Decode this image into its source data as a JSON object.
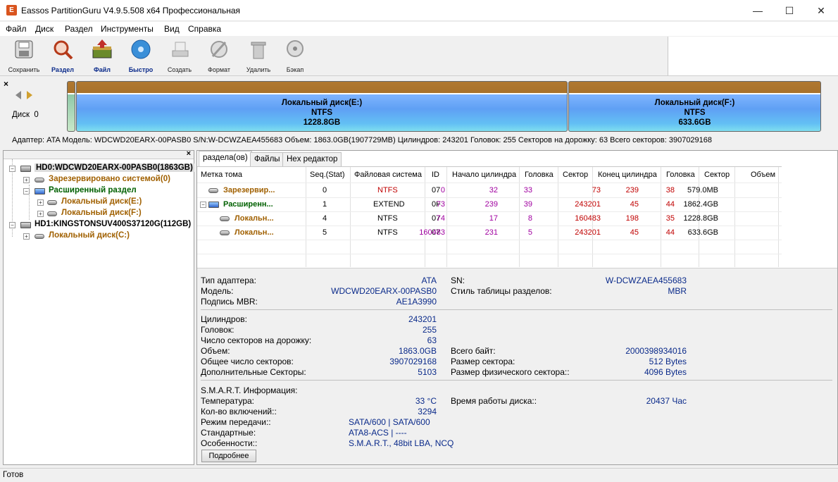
{
  "window": {
    "title": "Eassos PartitionGuru V4.9.5.508 x64 Профессиональная",
    "minimize": "—",
    "maximize": "☐",
    "close": "✕"
  },
  "menu": [
    "Файл",
    "Диск",
    "Раздел",
    "Инструменты",
    "Вид",
    "Справка"
  ],
  "toolbar": [
    {
      "label": "Сохранить",
      "icon": "save-icon"
    },
    {
      "label": "Раздел",
      "icon": "partition-search-icon"
    },
    {
      "label": "Файл",
      "icon": "file-recovery-icon"
    },
    {
      "label": "Быстро",
      "icon": "quick-icon"
    },
    {
      "label": "Создать",
      "icon": "create-icon"
    },
    {
      "label": "Формат",
      "icon": "format-icon"
    },
    {
      "label": "Удалить",
      "icon": "delete-icon"
    },
    {
      "label": "Бэкап",
      "icon": "backup-icon"
    }
  ],
  "diskmap": {
    "close": "×",
    "disk_label": "Диск  0",
    "partitions": [
      {
        "name": "Локальный диск(E:)",
        "fs": "NTFS",
        "size": "1228.8GB"
      },
      {
        "name": "Локальный диск(F:)",
        "fs": "NTFS",
        "size": "633.6GB"
      }
    ],
    "adapter_line": "Адаптер: ATA  Модель: WDCWD20EARX-00PASB0  S/N:W-DCWZAEA455683  Объем: 1863.0GB(1907729MB)  Цилиндров: 243201 Головок: 255  Секторов на дорожку: 63  Всего секторов: 3907029168"
  },
  "tree": {
    "close": "×",
    "nodes": [
      {
        "label": "HD0:WDCWD20EARX-00PASB0(1863GB)"
      },
      {
        "label": "Зарезервировано системой(0)"
      },
      {
        "label": "Расширенный раздел"
      },
      {
        "label": "Локальный диск(E:)"
      },
      {
        "label": "Локальный диск(F:)"
      },
      {
        "label": "HD1:KINGSTONSUV400S37120G(112GB)"
      },
      {
        "label": "Локальный диск(C:)"
      }
    ]
  },
  "tabs": [
    "разделa(ов)",
    "Файлы",
    "Hex редактор"
  ],
  "table": {
    "headers": [
      "Метка тома",
      "Seq.(Stat)",
      "Файловая система",
      "ID",
      "Начало цилиндра",
      "Головка",
      "Сектор",
      "Конец цилиндра",
      "Головка",
      "Сектор",
      "Объем"
    ],
    "rows": [
      [
        "Зарезервир...",
        "0",
        "NTFS",
        "07",
        "0",
        "32",
        "33",
        "73",
        "239",
        "38",
        "579.0MB"
      ],
      [
        "Расширенн...",
        "1",
        "EXTEND",
        "0F",
        "73",
        "239",
        "39",
        "243201",
        "45",
        "44",
        "1862.4GB"
      ],
      [
        "Локальн...",
        "4",
        "NTFS",
        "07",
        "74",
        "17",
        "8",
        "160483",
        "198",
        "35",
        "1228.8GB"
      ],
      [
        "Локальн...",
        "5",
        "NTFS",
        "07",
        "160483",
        "231",
        "5",
        "243201",
        "45",
        "44",
        "633.6GB"
      ]
    ]
  },
  "info": {
    "adapter_type_label": "Тип адаптера:",
    "adapter_type": "ATA",
    "model_label": "Модель:",
    "model": "WDCWD20EARX-00PASB0",
    "mbr_sig_label": "Подпись MBR:",
    "mbr_sig": "AE1A3990",
    "sn_label": "SN:",
    "sn": "W-DCWZAEA455683",
    "ptable_label": "Стиль таблицы разделов:",
    "ptable": "MBR",
    "cyl_label": "Цилиндров:",
    "cyl": "243201",
    "heads_label": "Головок:",
    "heads": "255",
    "spt_label": "Число секторов на дорожку:",
    "spt": "63",
    "cap_label": "Объем:",
    "cap": "1863.0GB",
    "total_sec_label": "Общее число секторов:",
    "total_sec": "3907029168",
    "extra_sec_label": "Дополнительные Секторы:",
    "extra_sec": "5103",
    "bytes_label": "Всего байт:",
    "bytes": "2000398934016",
    "secsize_label": "Размер сектора:",
    "secsize": "512 Bytes",
    "physsec_label": "Размер физического сектора::",
    "physsec": "4096 Bytes",
    "smart_label": "S.M.A.R.T. Информация:",
    "temp_label": "Температура:",
    "temp": "33 °C",
    "power_label": "Кол-во включений::",
    "power": "3294",
    "xfer_label": "Режим передачи::",
    "xfer": "SATA/600 | SATA/600",
    "std_label": "Стандартные:",
    "std": "ATA8-ACS | ----",
    "feat_label": "Особенности::",
    "feat": "S.M.A.R.T., 48bit LBA, NCQ",
    "hours_label": "Время работы диска::",
    "hours": "20437 Час",
    "more_button": "Подробнее"
  },
  "status": "Готов"
}
